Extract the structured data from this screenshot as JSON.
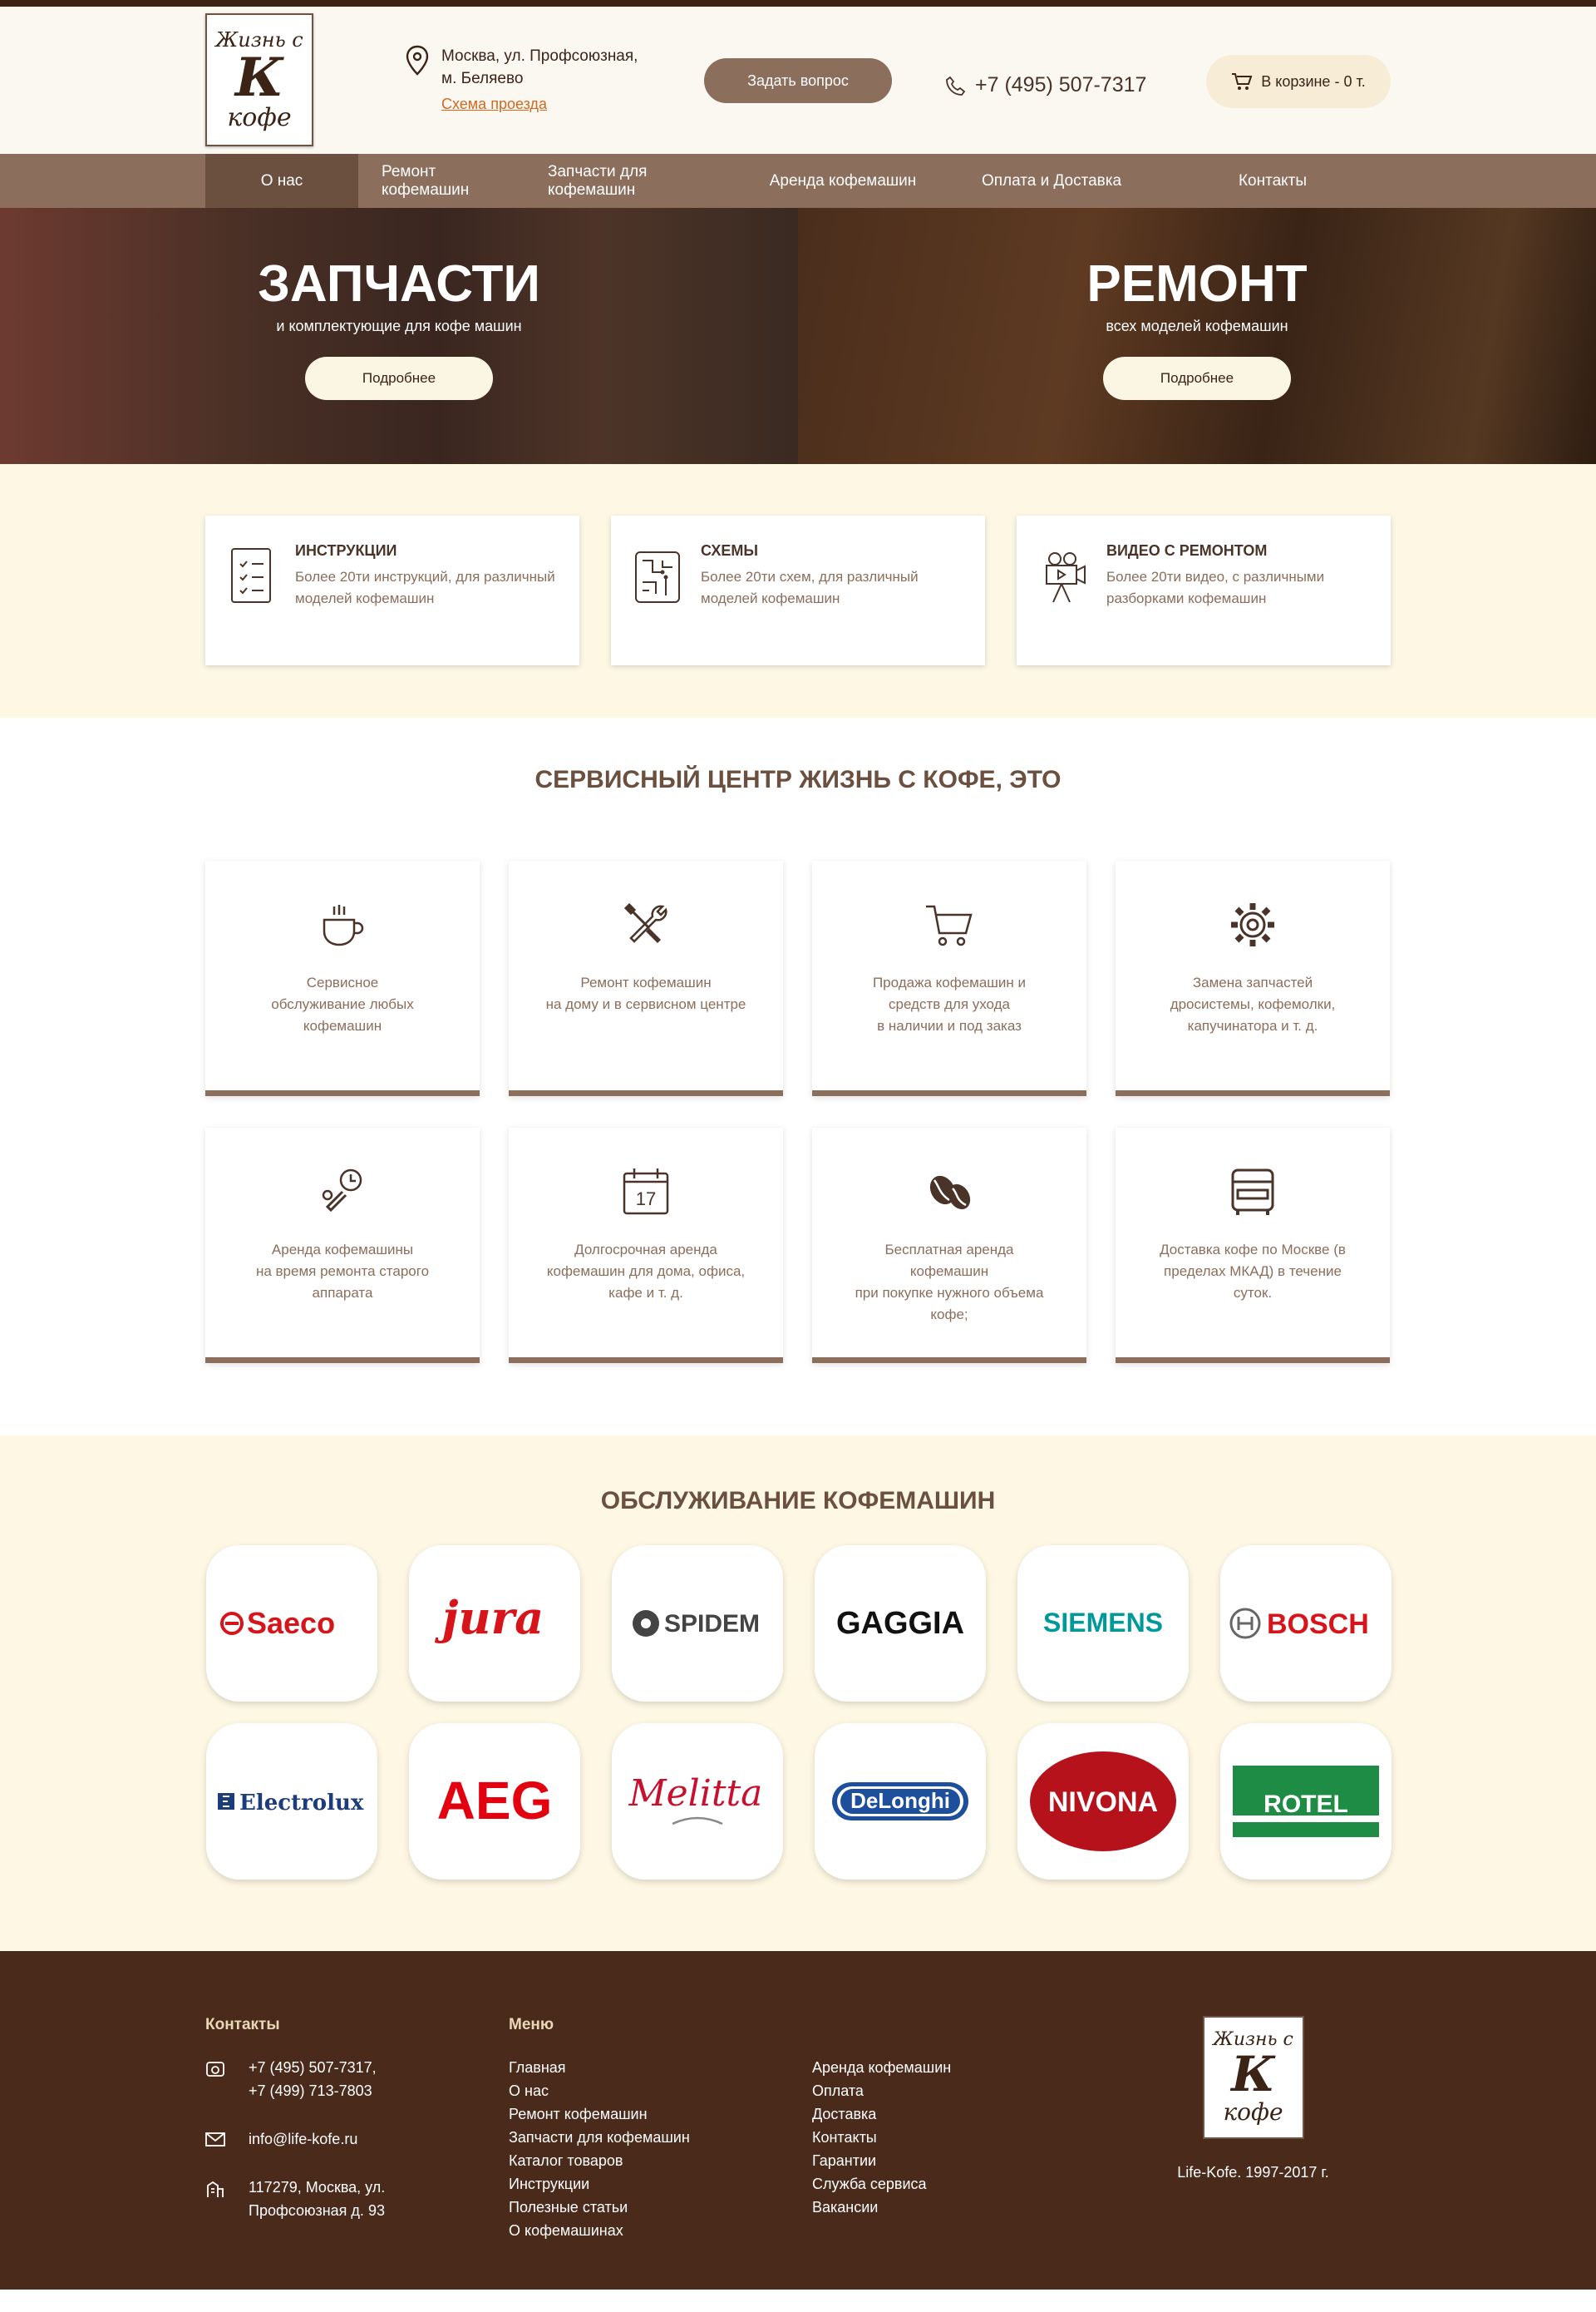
{
  "header": {
    "logo": {
      "line1": "Жизнь с",
      "line2": "К",
      "line3": "кофе"
    },
    "address_line1": "Москва, ул. Профсоюзная,",
    "address_line2": "м. Беляево",
    "route_link": "Схема проезда",
    "ask_button": "Задать вопрос",
    "phone": "+7 (495) 507-7317",
    "cart": "В корзине - 0 т."
  },
  "nav": [
    {
      "label": "О нас"
    },
    {
      "label": "Ремонт кофемашин"
    },
    {
      "label": "Запчасти для кофемашин"
    },
    {
      "label": "Аренда кофемашин"
    },
    {
      "label": "Оплата и Доставка"
    },
    {
      "label": "Контакты"
    }
  ],
  "hero": {
    "left": {
      "title": "ЗАПЧАСТИ",
      "subtitle": "и комплектующие для кофе машин",
      "button": "Подробнее"
    },
    "right": {
      "title": "РЕМОНТ",
      "subtitle": "всех моделей кофемашин",
      "button": "Подробнее"
    }
  },
  "features": [
    {
      "title": "ИНСТРУКЦИИ",
      "text": "Более 20ти инструкций, для различный моделей кофемашин",
      "icon": "document-checklist-icon"
    },
    {
      "title": "СХЕМЫ",
      "text": "Более 20ти схем, для различный моделей кофемашин",
      "icon": "circuit-board-icon"
    },
    {
      "title": "ВИДЕО С РЕМОНТОМ",
      "text": "Более 20ти видео, с различными разборками кофемашин",
      "icon": "video-camera-icon"
    }
  ],
  "services": {
    "title": "СЕРВИСНЫЙ ЦЕНТР ЖИЗНЬ С КОФЕ, ЭТО",
    "items": [
      {
        "text": "Сервисное\nобслуживание любых\nкофемашин",
        "icon": "coffee-cup-icon"
      },
      {
        "text": "Ремонт кофемашин\nна дому и в сервисном центре",
        "icon": "tools-icon"
      },
      {
        "text": "Продажа кофемашин и\nсредств для ухода\nв наличии и под заказ",
        "icon": "cart-icon"
      },
      {
        "text": "Замена запчастей\nдросистемы, кофемолки,\nкапучинатора и т. д.",
        "icon": "gear-icon"
      },
      {
        "text": "Аренда кофемашины\nна время ремонта старого\nаппарата",
        "icon": "wrench-clock-icon"
      },
      {
        "text": "Долгосрочная аренда\nкофемашин для дома, офиса,\nкафе и т. д.",
        "icon": "calendar-icon",
        "calendar_day": "17"
      },
      {
        "text": "Бесплатная аренда\nкофемашин\nпри покупке нужного объема\nкофе;",
        "icon": "coffee-beans-icon"
      },
      {
        "text": "Доставка кофе по Москве (в\nпределах МКАД) в течение\nсуток.",
        "icon": "bus-icon"
      }
    ]
  },
  "brands": {
    "title": "ОБСЛУЖИВАНИЕ КОФЕМАШИН",
    "items": [
      {
        "name": "Saeco",
        "color": "#d7141a"
      },
      {
        "name": "jura",
        "color": "#d7141a"
      },
      {
        "name": "SPIDEM",
        "color": "#444444"
      },
      {
        "name": "GAGGIA",
        "color": "#111111"
      },
      {
        "name": "SIEMENS",
        "color": "#009999"
      },
      {
        "name": "BOSCH",
        "color": "#d7141a"
      },
      {
        "name": "Electrolux",
        "color": "#1d3c7a"
      },
      {
        "name": "AEG",
        "color": "#e3000f"
      },
      {
        "name": "Melitta",
        "color": "#c8102e"
      },
      {
        "name": "DeLonghi",
        "color": "#1d4f9c"
      },
      {
        "name": "NIVONA",
        "color": "#b5121b"
      },
      {
        "name": "ROTEL",
        "color": "#1e8c45"
      }
    ]
  },
  "footer": {
    "contacts_title": "Контакты",
    "phones": [
      "+7 (495) 507-7317,",
      "+7 (499) 713-7803"
    ],
    "email": "info@life-kofe.ru",
    "address": [
      "117279, Москва, ул.",
      "Профсоюзная д. 93"
    ],
    "menu_title": "Меню",
    "menu_col1": [
      "Главная",
      "О нас",
      "Ремонт кофемашин",
      "Запчасти для кофемашин",
      "Каталог товаров",
      "Инструкции",
      "Полезные статьи",
      "О кофемашинах"
    ],
    "menu_col2": [
      "Аренда кофемашин",
      "Оплата",
      "Доставка",
      "Контакты",
      "Гарантии",
      "Служба сервиса",
      "Вакансии"
    ],
    "logo": {
      "line1": "Жизнь с",
      "line2": "К",
      "line3": "кофе"
    },
    "copyright": "Life-Kofe. 1997-2017 г."
  },
  "colors": {
    "dark": "#3b2316",
    "brown": "#8b6e5c",
    "cream": "#fdf7e4",
    "link": "#d2691e"
  }
}
